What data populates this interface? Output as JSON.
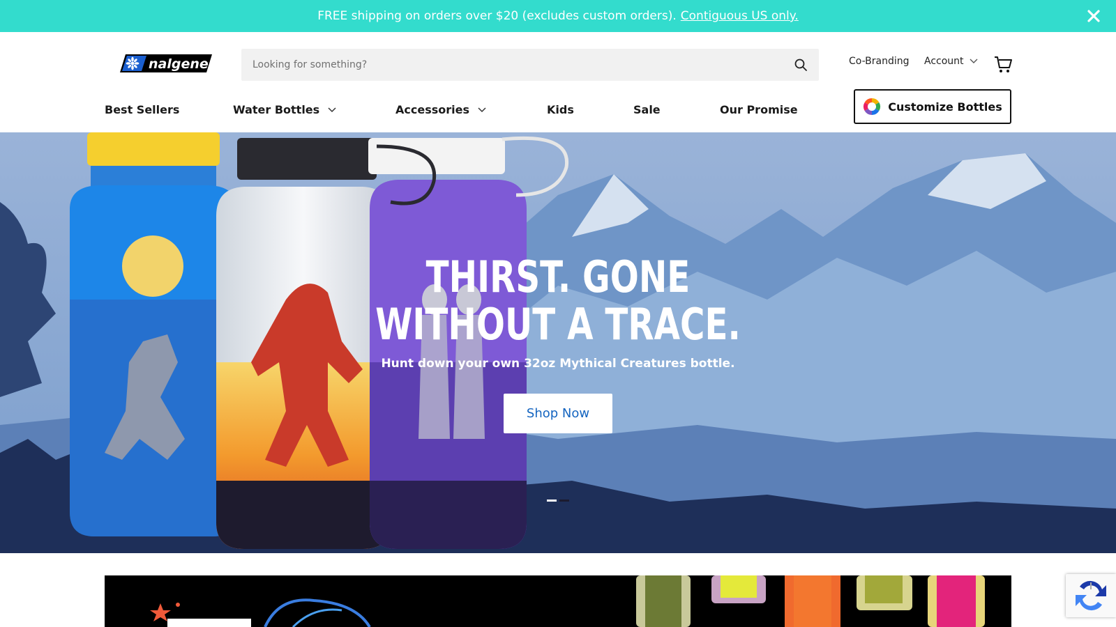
{
  "announcement": {
    "text": "FREE shipping on orders over $20 (excludes custom orders).",
    "link": "Contiguous US only.",
    "close_icon": "close-icon"
  },
  "header": {
    "logo_text": "nalgene",
    "search": {
      "placeholder": "Looking for something?",
      "value": "",
      "icon": "search-icon"
    },
    "cobranding": "Co-Branding",
    "account": "Account",
    "cart_icon": "cart-icon"
  },
  "nav": {
    "items": [
      {
        "label": "Best Sellers",
        "has_dropdown": false
      },
      {
        "label": "Water Bottles",
        "has_dropdown": true
      },
      {
        "label": "Accessories",
        "has_dropdown": true
      },
      {
        "label": "Kids",
        "has_dropdown": false
      },
      {
        "label": "Sale",
        "has_dropdown": false
      },
      {
        "label": "Our Promise",
        "has_dropdown": false
      }
    ],
    "customize": "Customize Bottles"
  },
  "hero": {
    "title_line1": "THIRST. GONE",
    "title_line2": "WITHOUT A TRACE.",
    "subtitle": "Hunt down your own 32oz Mythical Creatures bottle.",
    "cta": "Shop Now",
    "slides": 2,
    "active_slide": 1
  },
  "colors": {
    "announcement_bg": "#33dccd",
    "cta_text": "#1565c0",
    "hero_sky": "#89a8d3"
  }
}
